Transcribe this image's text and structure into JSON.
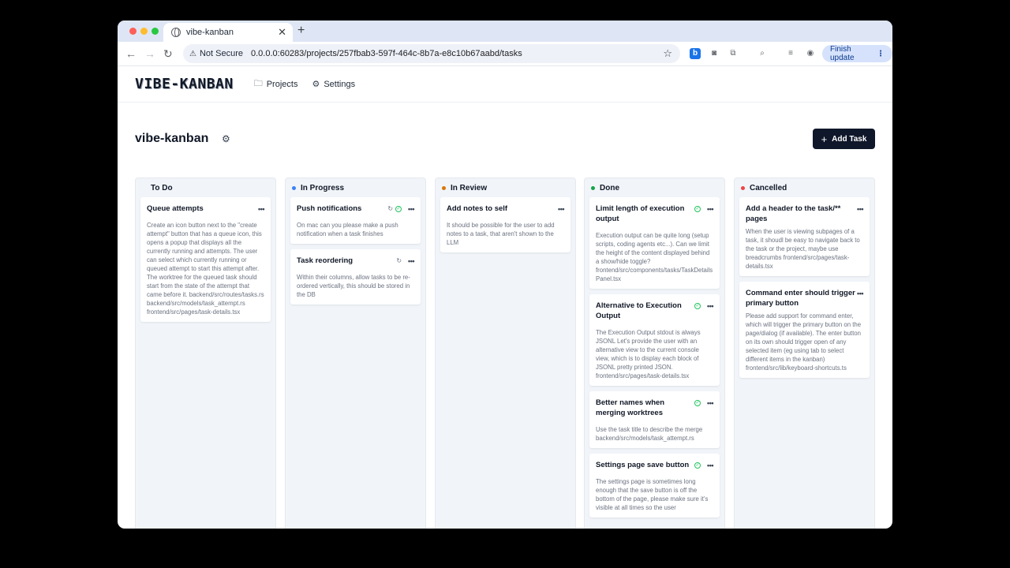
{
  "browser": {
    "tab_title": "vibe-kanban",
    "security_label": "Not Secure",
    "url": "0.0.0.0:60283/projects/257fbab3-597f-464c-8b7a-e8c10b67aabd/tasks",
    "finish_update": "Finish update",
    "traffic_colors": [
      "#ff5f57",
      "#febc2e",
      "#28c840"
    ]
  },
  "app": {
    "logo": "VIBE-KANBAN",
    "nav": {
      "projects": "Projects",
      "settings": "Settings"
    }
  },
  "page": {
    "title": "vibe-kanban",
    "add_task": "Add Task"
  },
  "columns": [
    {
      "name": "To Do",
      "dot": "",
      "cards": [
        {
          "title": "Queue attempts",
          "status": [],
          "desc": "Create an icon button next to the \"create attempt\" button that has a queue icon, this opens a popup that displays all the currently running and attempts. The user can select which currently running or queued attempt to start this attempt after. The worktree for the queued task should start from the state of the attempt that came before it. backend/src/routes/tasks.rs backend/src/models/task_attempt.rs frontend/src/pages/task-details.tsx"
        }
      ]
    },
    {
      "name": "In Progress",
      "dot": "#3b82f6",
      "cards": [
        {
          "title": "Push notifications",
          "status": [
            "spinner",
            "check"
          ],
          "desc": "On mac can you please make a push notification when a task finishes"
        },
        {
          "title": "Task reordering",
          "status": [
            "spinner"
          ],
          "desc": "Within their columns, allow tasks to be re-ordered vertically, this should be stored in the DB"
        }
      ]
    },
    {
      "name": "In Review",
      "dot": "#d97706",
      "cards": [
        {
          "title": "Add notes to self",
          "status": [],
          "desc": "It should be possible for the user to add notes to a task, that aren't shown to the LLM"
        }
      ]
    },
    {
      "name": "Done",
      "dot": "#16a34a",
      "cards": [
        {
          "title": "Limit length of execution output",
          "status": [
            "check"
          ],
          "desc": "Execution output can be quite long (setup scripts, coding agents etc...). Can we limit the height of the content displayed behind a show/hide toggle? frontend/src/components/tasks/TaskDetailsPanel.tsx"
        },
        {
          "title": "Alternative to Execution Output",
          "status": [
            "check"
          ],
          "desc": "The Execution Output stdout is always JSONL Let's provide the user with an alternative view to the current console view, which is to display each block of JSONL pretty printed JSON. frontend/src/pages/task-details.tsx"
        },
        {
          "title": "Better names when merging worktrees",
          "status": [
            "check"
          ],
          "desc": "Use the task title to describe the merge backend/src/models/task_attempt.rs"
        },
        {
          "title": "Settings page save button",
          "status": [
            "check"
          ],
          "desc": "The settings page is sometimes long enough that the save button is off the bottom of the page, please make sure it's visible at all times so the user"
        }
      ]
    },
    {
      "name": "Cancelled",
      "dot": "#ef4444",
      "cards": [
        {
          "title": "Add a header to the task/** pages",
          "status": [],
          "desc": "When the user is viewing subpages of a task, it shoudl be easy to navigate back to the task or the project, maybe use breadcrumbs frontend/src/pages/task-details.tsx"
        },
        {
          "title": "Command enter should trigger primary button",
          "status": [],
          "desc": "Please add support for command enter, which will trigger the primary button on the page/dialog (if available). The enter button on its own should trigger open of any selected item (eg using tab to select different items in the kanban) frontend/src/lib/keyboard-shortcuts.ts"
        }
      ]
    }
  ]
}
